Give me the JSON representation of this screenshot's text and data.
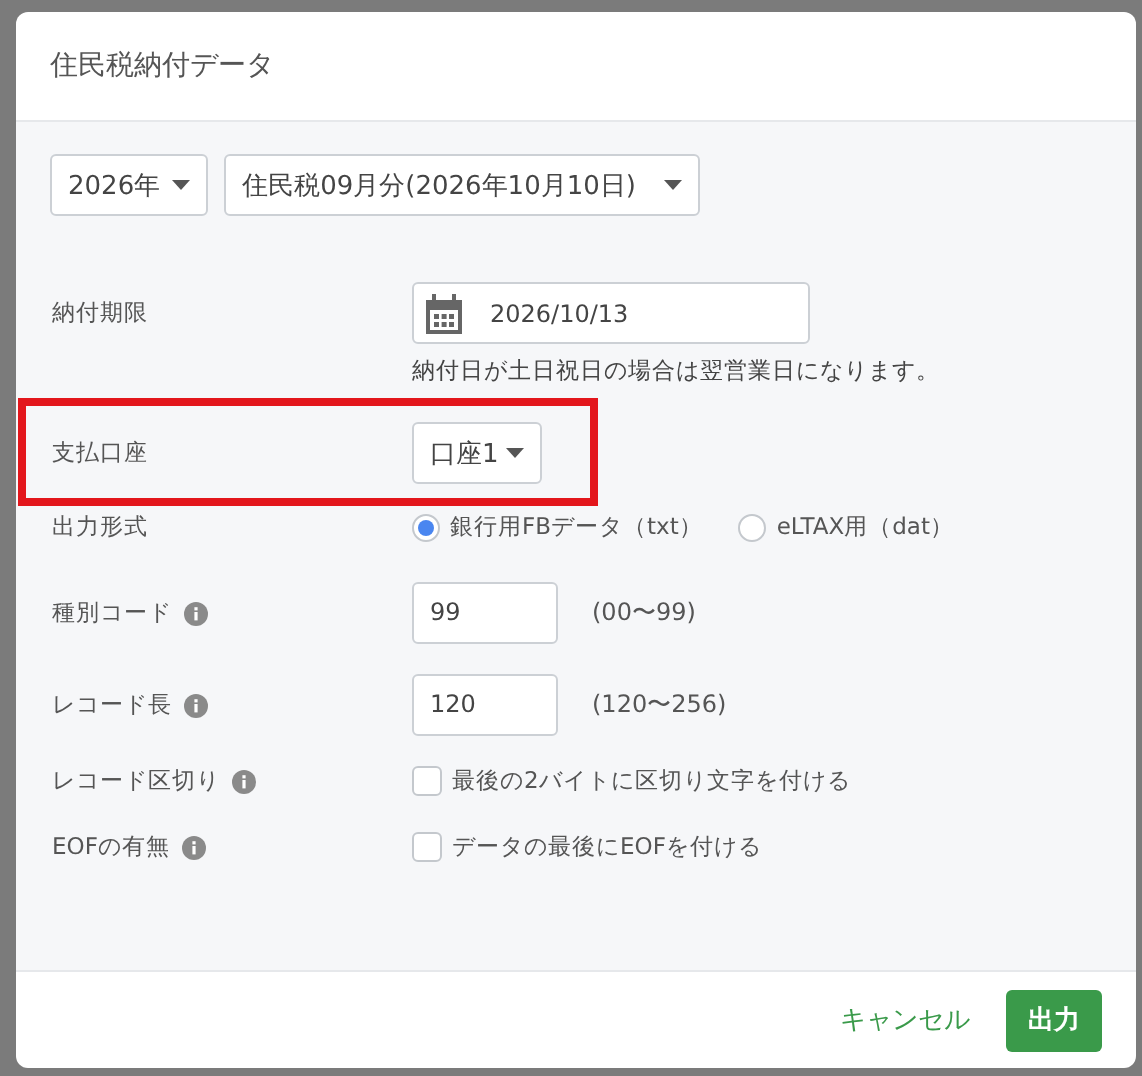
{
  "dialog": {
    "title": "住民税納付データ"
  },
  "period_selects": [
    {
      "value": "2026年"
    },
    {
      "value": "住民税09月分(2026年10月10日)"
    }
  ],
  "form_rows": [
    {
      "kind": "date",
      "label": "納付期限",
      "info": false,
      "highlighted": false,
      "value": "2026/10/13",
      "note": "納付日が土日祝日の場合は翌営業日になります。"
    },
    {
      "kind": "select",
      "label": "支払口座",
      "info": false,
      "highlighted": true,
      "value": "口座1"
    },
    {
      "kind": "radio",
      "label": "出力形式",
      "info": false,
      "highlighted": false,
      "options": [
        {
          "label": "銀行用FBデータ（txt）",
          "selected": true
        },
        {
          "label": "eLTAX用（dat）",
          "selected": false
        }
      ]
    },
    {
      "kind": "number",
      "label": "種別コード",
      "info": true,
      "highlighted": false,
      "value": "99",
      "range": "(00〜99)"
    },
    {
      "kind": "number",
      "label": "レコード長",
      "info": true,
      "highlighted": false,
      "value": "120",
      "range": "(120〜256)"
    },
    {
      "kind": "checkbox",
      "label": "レコード区切り",
      "info": true,
      "highlighted": false,
      "checked": false,
      "text": "最後の2バイトに区切り文字を付ける"
    },
    {
      "kind": "checkbox",
      "label": "EOFの有無",
      "info": true,
      "highlighted": false,
      "checked": false,
      "text": "データの最後にEOFを付ける"
    }
  ],
  "buttons": {
    "cancel": "キャンセル",
    "submit": "出力"
  }
}
